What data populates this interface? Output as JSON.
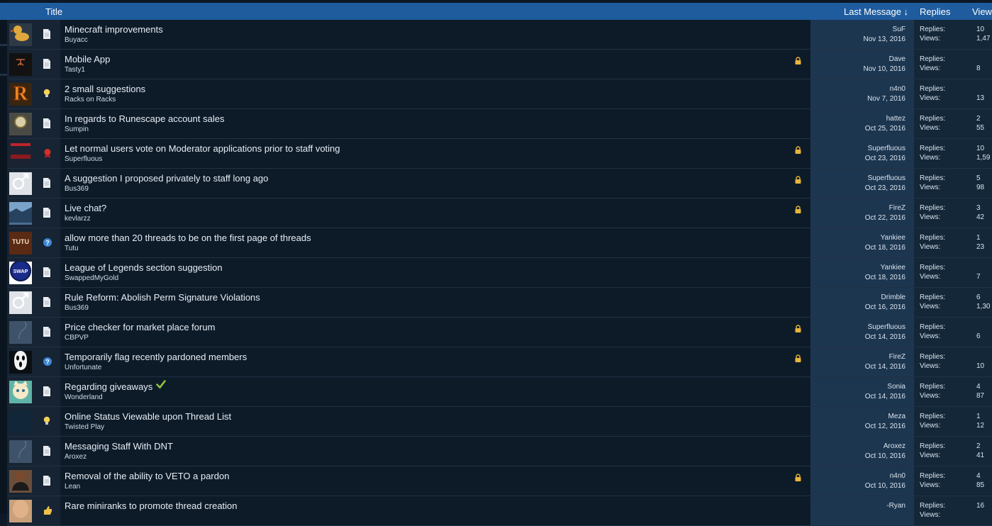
{
  "header": {
    "title_label": "Title",
    "last_message_label": "Last Message ↓",
    "replies_label": "Replies",
    "views_label": "View"
  },
  "stat_labels": {
    "replies": "Replies:",
    "views": "Views:"
  },
  "colors": {
    "header_bg": "#1f5c9e",
    "row_bg": "#0d1b29",
    "last_message_bg": "#1d3650",
    "stats_bg": "#142738",
    "lock": "#e8b43a",
    "solved_check": "#8fc43a"
  },
  "threads": [
    {
      "title": "Minecraft improvements",
      "author": "Buyacc",
      "prefix_icon": "document-icon",
      "locked": false,
      "last_user": "SuF",
      "last_date": "Nov 13, 2016",
      "replies": "10",
      "views": "1,47",
      "avatar_icon": "duck-icon",
      "avatar_bg": "#2d3a46"
    },
    {
      "title": "Mobile App",
      "author": "Tasty1",
      "prefix_icon": "document-icon",
      "locked": true,
      "last_user": "Dave",
      "last_date": "Nov 10, 2016",
      "replies": "",
      "views": "8",
      "avatar_icon": "dark-logo-icon",
      "avatar_bg": "#121212"
    },
    {
      "title": "2 small suggestions",
      "author": "Racks on Racks",
      "prefix_icon": "lightbulb-icon",
      "locked": false,
      "last_user": "n4n0",
      "last_date": "Nov 7, 2016",
      "replies": "",
      "views": "13",
      "avatar_icon": "letter-r-icon",
      "avatar_bg": "#3a2510",
      "avatar_letter": "R"
    },
    {
      "title": "In regards to Runescape account sales",
      "author": "Sumpin",
      "prefix_icon": "document-icon",
      "locked": false,
      "last_user": "hattez",
      "last_date": "Oct 25, 2016",
      "replies": "2",
      "views": "55",
      "avatar_icon": "watch-photo-icon",
      "avatar_bg": "#4a4a44"
    },
    {
      "title": "Let normal users vote on Moderator applications prior to staff voting",
      "author": "Superfluous",
      "prefix_icon": "award-icon",
      "locked": true,
      "last_user": "Superfluous",
      "last_date": "Oct 23, 2016",
      "replies": "10",
      "views": "1,59",
      "avatar_icon": "banner-icon",
      "avatar_bg": "#1c2433"
    },
    {
      "title": "A suggestion I proposed privately to staff long ago",
      "author": "Bus369",
      "prefix_icon": "document-icon",
      "locked": true,
      "last_user": "Superfluous",
      "last_date": "Oct 23, 2016",
      "replies": "5",
      "views": "98",
      "avatar_icon": "male-symbol-icon",
      "avatar_bg": "#dfe3e8"
    },
    {
      "title": "Live chat?",
      "author": "kevlarzz",
      "prefix_icon": "document-icon",
      "locked": true,
      "last_user": "FireZ",
      "last_date": "Oct 22, 2016",
      "replies": "3",
      "views": "42",
      "avatar_icon": "landscape-photo-icon",
      "avatar_bg": "#4b6f93"
    },
    {
      "title": "allow more than 20 threads to be on the first page of threads",
      "author": "Tutu",
      "prefix_icon": "question-icon",
      "locked": false,
      "last_user": "Yankiee",
      "last_date": "Oct 18, 2016",
      "replies": "1",
      "views": "23",
      "avatar_icon": "tutu-logo-icon",
      "avatar_bg": "#5a2a14",
      "avatar_letter": "TUTU"
    },
    {
      "title": "League of Legends section suggestion",
      "author": "SwappedMyGold",
      "prefix_icon": "document-icon",
      "locked": false,
      "last_user": "Yankiee",
      "last_date": "Oct 18, 2016",
      "replies": "",
      "views": "7",
      "avatar_icon": "swap-logo-icon",
      "avatar_bg": "#ffffff",
      "avatar_letter": "SWAP"
    },
    {
      "title": "Rule Reform: Abolish Perm Signature Violations",
      "author": "Bus369",
      "prefix_icon": "document-icon",
      "locked": false,
      "last_user": "Drimble",
      "last_date": "Oct 16, 2016",
      "replies": "6",
      "views": "1,30",
      "avatar_icon": "male-symbol-icon",
      "avatar_bg": "#dfe3e8"
    },
    {
      "title": "Price checker for market place forum",
      "author": "CBPVP",
      "prefix_icon": "document-icon",
      "locked": true,
      "last_user": "Superfluous",
      "last_date": "Oct 14, 2016",
      "replies": "",
      "views": "6",
      "avatar_icon": "default-avatar-icon",
      "avatar_bg": "#3e536a"
    },
    {
      "title": "Temporarily flag recently pardoned members",
      "author": "Unfortunate",
      "prefix_icon": "question-icon",
      "locked": true,
      "last_user": "FireZ",
      "last_date": "Oct 14, 2016",
      "replies": "",
      "views": "10",
      "avatar_icon": "ghost-mask-icon",
      "avatar_bg": "#0a0f14"
    },
    {
      "title": "Regarding giveaways",
      "author": "Wonderland",
      "prefix_icon": "document-icon",
      "locked": false,
      "solved": true,
      "last_user": "Sonia",
      "last_date": "Oct 14, 2016",
      "replies": "4",
      "views": "87",
      "avatar_icon": "cartoon-cat-icon",
      "avatar_bg": "#5fb3a8"
    },
    {
      "title": "Online Status Viewable upon Thread List",
      "author": "Twisted Play",
      "prefix_icon": "lightbulb-icon",
      "locked": false,
      "last_user": "Meza",
      "last_date": "Oct 12, 2016",
      "replies": "1",
      "views": "12",
      "avatar_icon": "dark-text-avatar-icon",
      "avatar_bg": "#12263a"
    },
    {
      "title": "Messaging Staff With DNT",
      "author": "Aroxez",
      "prefix_icon": "document-icon",
      "locked": false,
      "last_user": "Aroxez",
      "last_date": "Oct 10, 2016",
      "replies": "2",
      "views": "41",
      "avatar_icon": "default-avatar-icon",
      "avatar_bg": "#3e536a"
    },
    {
      "title": "Removal of the ability to VETO a pardon",
      "author": "Lean",
      "prefix_icon": "document-icon",
      "locked": true,
      "last_user": "n4n0",
      "last_date": "Oct 10, 2016",
      "replies": "4",
      "views": "85",
      "avatar_icon": "portrait-photo-icon",
      "avatar_bg": "#6b4e3a"
    },
    {
      "title": "Rare miniranks to promote thread creation",
      "author": "",
      "prefix_icon": "thumbs-up-icon",
      "locked": false,
      "last_user": "-Ryan",
      "last_date": "",
      "replies": "16",
      "views": "",
      "avatar_icon": "bald-head-icon",
      "avatar_bg": "#c9a07a"
    }
  ]
}
